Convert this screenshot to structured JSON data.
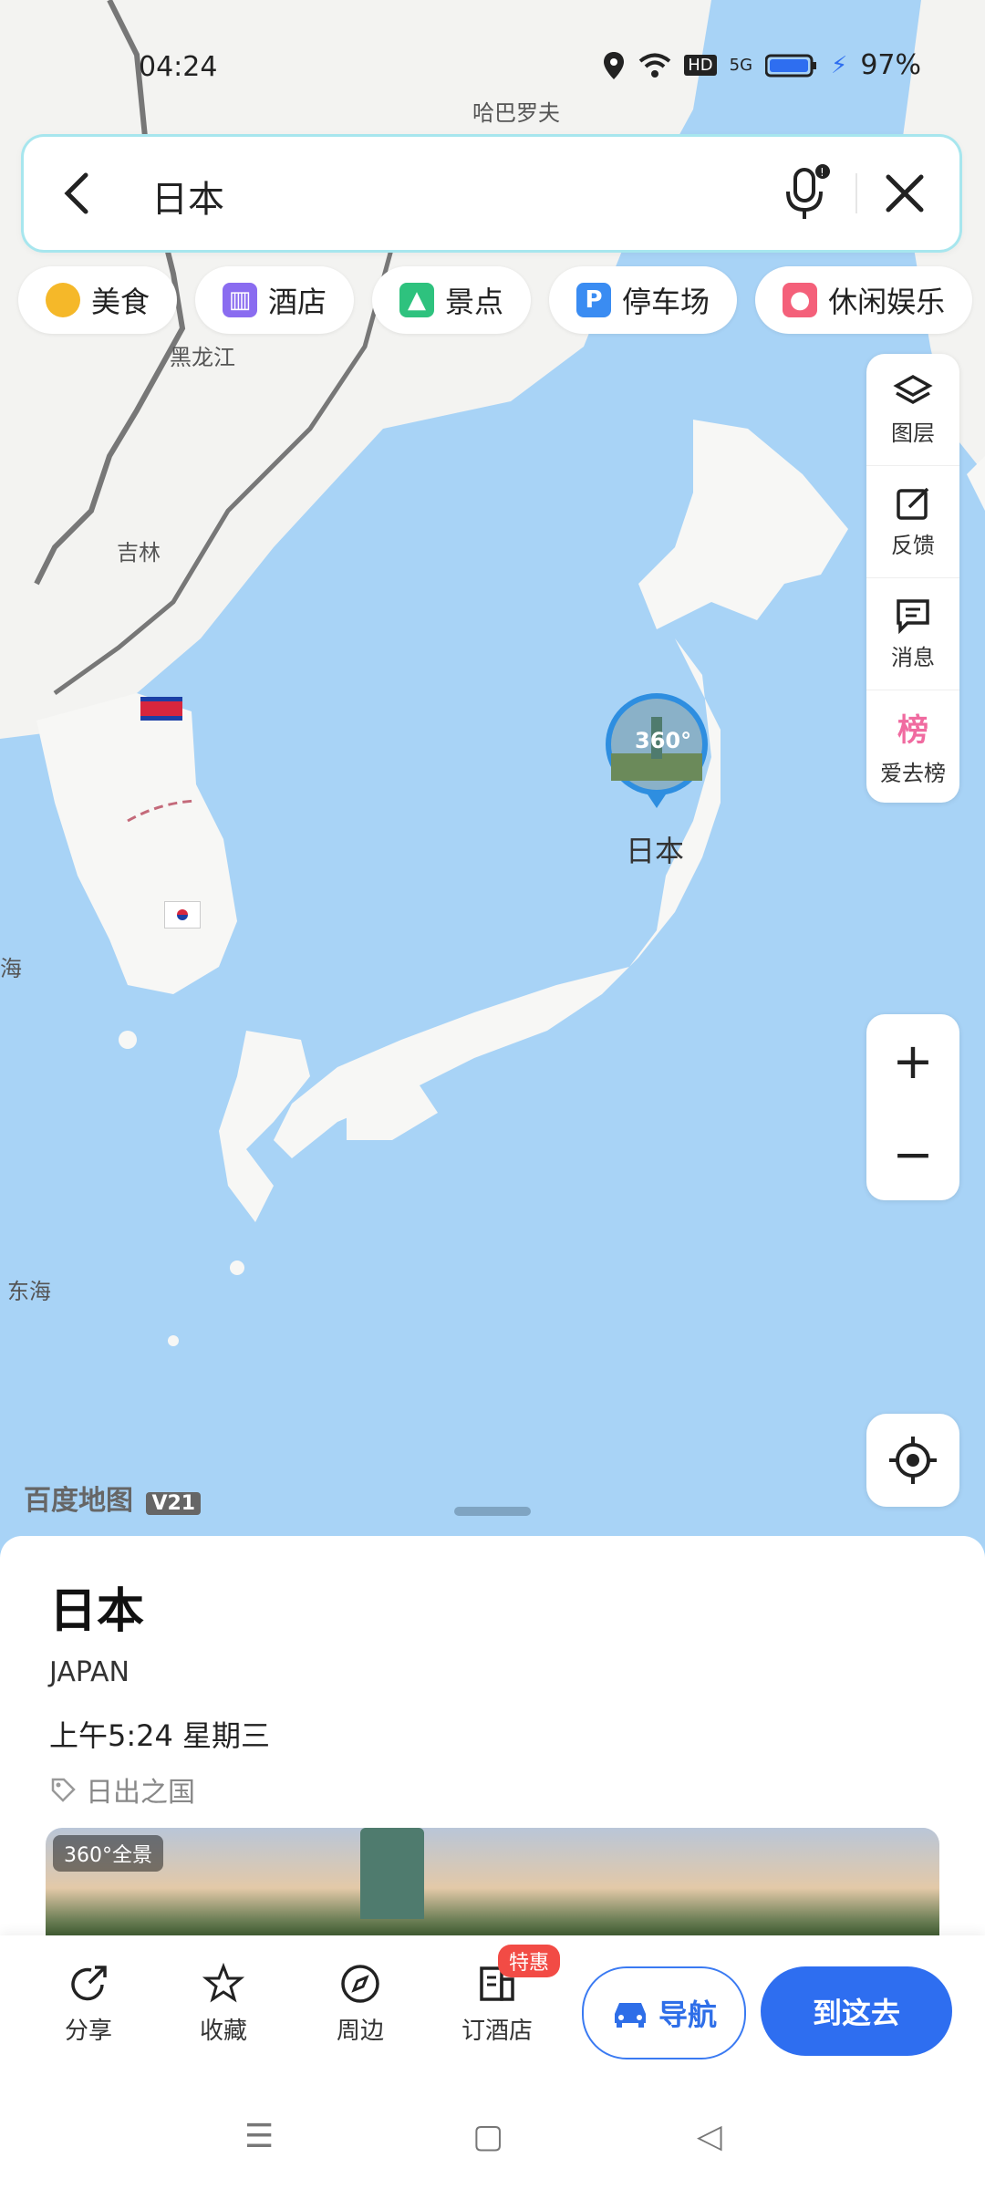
{
  "status_bar": {
    "time": "04:24",
    "network": "5G",
    "hd": "HD",
    "battery": "97%"
  },
  "search": {
    "query": "日本"
  },
  "categories": [
    {
      "label": "美食",
      "icon": "food-icon",
      "color": "#f5b829"
    },
    {
      "label": "酒店",
      "icon": "hotel-icon",
      "color": "#8a6cf0"
    },
    {
      "label": "景点",
      "icon": "scenic-icon",
      "color": "#2ec27e"
    },
    {
      "label": "停车场",
      "icon": "parking-icon",
      "color": "#3a8cf2"
    },
    {
      "label": "休闲娱乐",
      "icon": "entertainment-icon",
      "color": "#f4607a"
    }
  ],
  "side_tools": [
    {
      "label": "图层",
      "icon": "layers-icon"
    },
    {
      "label": "反馈",
      "icon": "feedback-icon"
    },
    {
      "label": "消息",
      "icon": "message-icon"
    },
    {
      "label": "爱去榜",
      "icon": "ranking-icon"
    }
  ],
  "map": {
    "labels": {
      "harbin": "哈巴罗夫",
      "heilongjiang": "黑龙江",
      "jilin": "吉林",
      "east_sea": "东海",
      "sea_edge": "海"
    },
    "marker_label": "日本",
    "marker_badge": "360°",
    "brand": "百度地图",
    "brand_version": "V21"
  },
  "place": {
    "name": "日本",
    "english": "JAPAN",
    "local_time": "上午5:24 星期三",
    "tag": "日出之国",
    "photo_badge": "360°全景"
  },
  "actions": [
    {
      "label": "分享",
      "icon": "share-icon"
    },
    {
      "label": "收藏",
      "icon": "star-icon"
    },
    {
      "label": "周边",
      "icon": "compass-icon"
    },
    {
      "label": "订酒店",
      "icon": "hotel-book-icon"
    }
  ],
  "hotel_badge": "特惠",
  "nav_button": "导航",
  "go_button": "到这去",
  "colors": {
    "primary": "#2e6ef0",
    "sea": "#a8d3f6",
    "badge_red": "#f24b45"
  }
}
